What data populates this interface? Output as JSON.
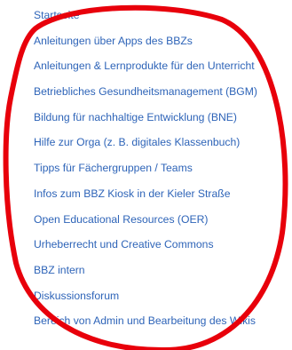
{
  "sidebar": {
    "items": [
      {
        "label": "Startseite"
      },
      {
        "label": "Anleitungen über Apps des BBZs"
      },
      {
        "label": "Anleitungen & Lernprodukte für den Unterricht"
      },
      {
        "label": "Betriebliches Gesundheitsmanagement (BGM)"
      },
      {
        "label": "Bildung für nachhaltige Entwicklung (BNE)"
      },
      {
        "label": "Hilfe zur Orga (z. B. digitales Klassenbuch)"
      },
      {
        "label": "Tipps für Fächergruppen / Teams"
      },
      {
        "label": "Infos zum BBZ Kiosk in der Kieler Straße"
      },
      {
        "label": "Open Educational Resources (OER)"
      },
      {
        "label": "Urheberrecht und Creative Commons"
      },
      {
        "label": "BBZ intern"
      },
      {
        "label": "Diskussionsforum"
      },
      {
        "label": "Bereich von Admin und Bearbeitung des Wikis"
      }
    ]
  },
  "colors": {
    "link": "#2e64b8",
    "annotation": "#e8000b",
    "background": "#ffffff"
  }
}
